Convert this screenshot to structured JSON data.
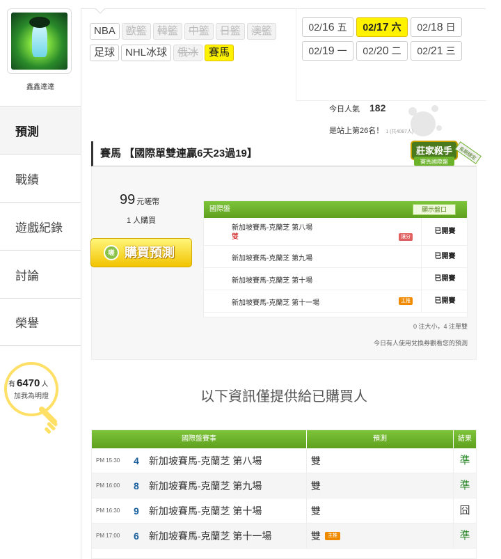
{
  "user": {
    "name": "鑫鑫達達"
  },
  "nav": [
    {
      "label": "預測",
      "active": true
    },
    {
      "label": "戰績"
    },
    {
      "label": "遊戲紀錄"
    },
    {
      "label": "討論"
    },
    {
      "label": "榮譽"
    }
  ],
  "fans": {
    "prefix": "有",
    "count": "6470",
    "suffix": "人",
    "text": "加我為明燈"
  },
  "sports": [
    {
      "label": "NBA",
      "state": "normal"
    },
    {
      "label": "歐籃",
      "state": "disabled"
    },
    {
      "label": "韓籃",
      "state": "disabled"
    },
    {
      "label": "中籃",
      "state": "disabled"
    },
    {
      "label": "日籃",
      "state": "disabled"
    },
    {
      "label": "澳籃",
      "state": "disabled"
    },
    {
      "label": "足球",
      "state": "normal"
    },
    {
      "label": "NHL冰球",
      "state": "normal"
    },
    {
      "label": "俄冰",
      "state": "disabled"
    },
    {
      "label": "賽馬",
      "state": "active"
    }
  ],
  "dates": [
    {
      "md": "02/",
      "day": "16",
      "wd": "五"
    },
    {
      "md": "02/",
      "day": "17",
      "wd": "六",
      "active": true
    },
    {
      "md": "02/",
      "day": "18",
      "wd": "日"
    },
    {
      "md": "02/",
      "day": "19",
      "wd": "一"
    },
    {
      "md": "02/",
      "day": "20",
      "wd": "二"
    },
    {
      "md": "02/",
      "day": "21",
      "wd": "三"
    }
  ],
  "stats": {
    "pop_label": "今日人氣",
    "pop_value": "182",
    "rank_text": "是站上第26名！",
    "rank_small": "1 (共4087人)"
  },
  "badge": {
    "line1": "莊家殺手",
    "line2": "賽馬國際盤",
    "ribbon": "長期穩定"
  },
  "title": "賽馬 【國際單雙連贏6天23過19】",
  "offer": {
    "price": "99",
    "unit": "元嗟幣",
    "buyers": "1 人購買",
    "buy_label": "購買預測",
    "buy_icon": "嗟"
  },
  "mini": {
    "header": "國際盤",
    "show_label": "顯示盤口",
    "rows": [
      {
        "race": "新加坡賽馬-克蘭芝 第八場",
        "sub": "雙",
        "tag": "讓分",
        "tag_color": "red",
        "status": "已開賽"
      },
      {
        "race": "新加坡賽馬-克蘭芝 第九場",
        "status": "已開賽"
      },
      {
        "race": "新加坡賽馬-克蘭芝 第十場",
        "status": "已開賽"
      },
      {
        "race": "新加坡賽馬-克蘭芝 第十一場",
        "tag": "主推",
        "tag_color": "orange",
        "status": "已開賽"
      }
    ],
    "note1": "0 注大小，4 注單雙",
    "note2": "今日有人使用兌換券觀看您的預測"
  },
  "info_text": "以下資訊僅提供給已購買人",
  "table": {
    "headers": [
      "國際盤賽事",
      "預測",
      "結果"
    ],
    "rows": [
      {
        "time": "PM 15:30",
        "no": "4",
        "race": "新加坡賽馬-克蘭芝 第八場",
        "pick": "雙",
        "result": "準",
        "result_type": "win"
      },
      {
        "time": "PM 16:00",
        "no": "8",
        "race": "新加坡賽馬-克蘭芝 第九場",
        "pick": "雙",
        "result": "準",
        "result_type": "win"
      },
      {
        "time": "PM 16:30",
        "no": "9",
        "race": "新加坡賽馬-克蘭芝 第十場",
        "pick": "雙",
        "result": "囧",
        "result_type": "lose"
      },
      {
        "time": "PM 17:00",
        "no": "6",
        "race": "新加坡賽馬-克蘭芝 第十一場",
        "pick": "雙",
        "tag": "主推",
        "result": "準",
        "result_type": "win"
      }
    ]
  },
  "colors": {
    "green": "#6cb32a",
    "yellow": "#fff200"
  }
}
